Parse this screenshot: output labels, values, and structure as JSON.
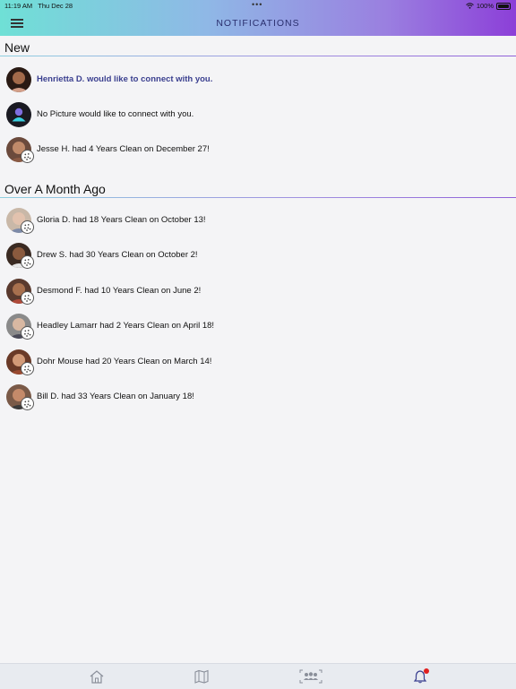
{
  "status_bar": {
    "time": "11:19 AM",
    "date": "Thu Dec 28",
    "battery": "100%"
  },
  "header": {
    "title": "NOTIFICATIONS",
    "menu_icon": "hamburger-menu-icon"
  },
  "sections": [
    {
      "title": "New",
      "items": [
        {
          "text": "Henrietta D. would like to connect with you.",
          "highlight": true,
          "badge": false,
          "avatar": "photo"
        },
        {
          "text": "No Picture would like to connect with you.",
          "highlight": false,
          "badge": false,
          "avatar": "placeholder"
        },
        {
          "text": "Jesse H. had 4 Years Clean on December 27!",
          "highlight": false,
          "badge": true,
          "avatar": "photo"
        }
      ]
    },
    {
      "title": "Over A Month Ago",
      "items": [
        {
          "text": "Gloria D. had 18 Years Clean on October 13!",
          "highlight": false,
          "badge": true,
          "avatar": "photo"
        },
        {
          "text": "Drew S. had 30 Years Clean on October 2!",
          "highlight": false,
          "badge": true,
          "avatar": "photo"
        },
        {
          "text": "Desmond F. had 10 Years Clean on June 2!",
          "highlight": false,
          "badge": true,
          "avatar": "photo"
        },
        {
          "text": "Headley Lamarr had 2 Years Clean on April 18!",
          "highlight": false,
          "badge": true,
          "avatar": "photo"
        },
        {
          "text": "Dohr Mouse had 20 Years Clean on March 14!",
          "highlight": false,
          "badge": true,
          "avatar": "photo"
        },
        {
          "text": "Bill D. had 33 Years Clean on January 18!",
          "highlight": false,
          "badge": true,
          "avatar": "photo"
        }
      ]
    }
  ],
  "tabbar": {
    "tabs": [
      {
        "icon": "home-icon",
        "active": false
      },
      {
        "icon": "map-icon",
        "active": false
      },
      {
        "icon": "group-icon",
        "active": false
      },
      {
        "icon": "bell-icon",
        "active": true,
        "has_notification": true
      }
    ]
  },
  "colors": {
    "accent": "#3a3f8f",
    "header_start": "#6fe0d6",
    "header_end": "#8c3fd8",
    "notification": "#e02020"
  }
}
